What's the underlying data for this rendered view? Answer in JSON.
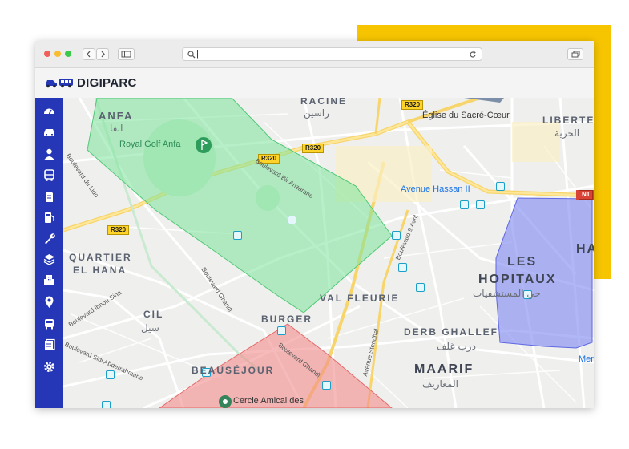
{
  "app": {
    "name": "DIGIPARC"
  },
  "browser": {
    "url": "|"
  },
  "sidebar": {
    "items": [
      {
        "icon": "dashboard-icon"
      },
      {
        "icon": "car-icon"
      },
      {
        "icon": "user-icon"
      },
      {
        "icon": "bus-icon"
      },
      {
        "icon": "document-icon"
      },
      {
        "icon": "fuel-pump-icon"
      },
      {
        "icon": "wrench-icon"
      },
      {
        "icon": "layers-icon"
      },
      {
        "icon": "building-icon"
      },
      {
        "icon": "map-pin-icon"
      },
      {
        "icon": "vehicle-front-icon"
      },
      {
        "icon": "report-icon"
      },
      {
        "icon": "settings-icon"
      }
    ]
  },
  "map": {
    "districts": [
      {
        "name": "RACINE",
        "arabic": "راسين"
      },
      {
        "name": "ANFA",
        "arabic": "انفا"
      },
      {
        "name": "LIBERTE",
        "arabic": "الحرية"
      },
      {
        "name": "QUARTIER",
        "name2": "EL HANA"
      },
      {
        "name": "CIL",
        "arabic": "سيل"
      },
      {
        "name": "LES",
        "name2": "HOPITAUX",
        "arabic": "حي المستشفيات"
      },
      {
        "name": "VAL FLEURIE"
      },
      {
        "name": "BURGER"
      },
      {
        "name": "DERB GHALLEF",
        "arabic": "درب غلف"
      },
      {
        "name": "BEAUSÉJOUR"
      },
      {
        "name": "MAARIF",
        "arabic": "المعاريف"
      },
      {
        "name": "HA"
      }
    ],
    "pois": {
      "royal_golf": "Royal Golf Anfa",
      "eglise": "Église du Sacré-Cœur",
      "avenue_hassan": "Avenue Hassan II",
      "cercle": "Cercle Amical des",
      "mer": "Mer"
    },
    "streets": {
      "lido": "Boulevard du Lido",
      "bir_anzarane": "Boulevard Bir Anzarane",
      "ibnou_sina": "Boulevard Ibnou Sina",
      "ghandi": "Boulevard Ghandi",
      "ghandi2": "Boulevard Ghandi",
      "sidi_abderrahmane": "Boulevard Sidi Abderrahmane",
      "avril": "Boulevard 9 Avril",
      "stendhal": "Avenue Stendhal"
    },
    "road_shields": [
      "R320",
      "R320",
      "R320",
      "R320",
      "N1"
    ],
    "zones": [
      {
        "name": "green-zone",
        "color": "#7CE39A"
      },
      {
        "name": "blue-zone",
        "color": "#7D86F2"
      },
      {
        "name": "red-zone",
        "color": "#F28C8C"
      }
    ]
  },
  "colors": {
    "accent": "#F7C500",
    "sidebar": "#2536B6"
  }
}
